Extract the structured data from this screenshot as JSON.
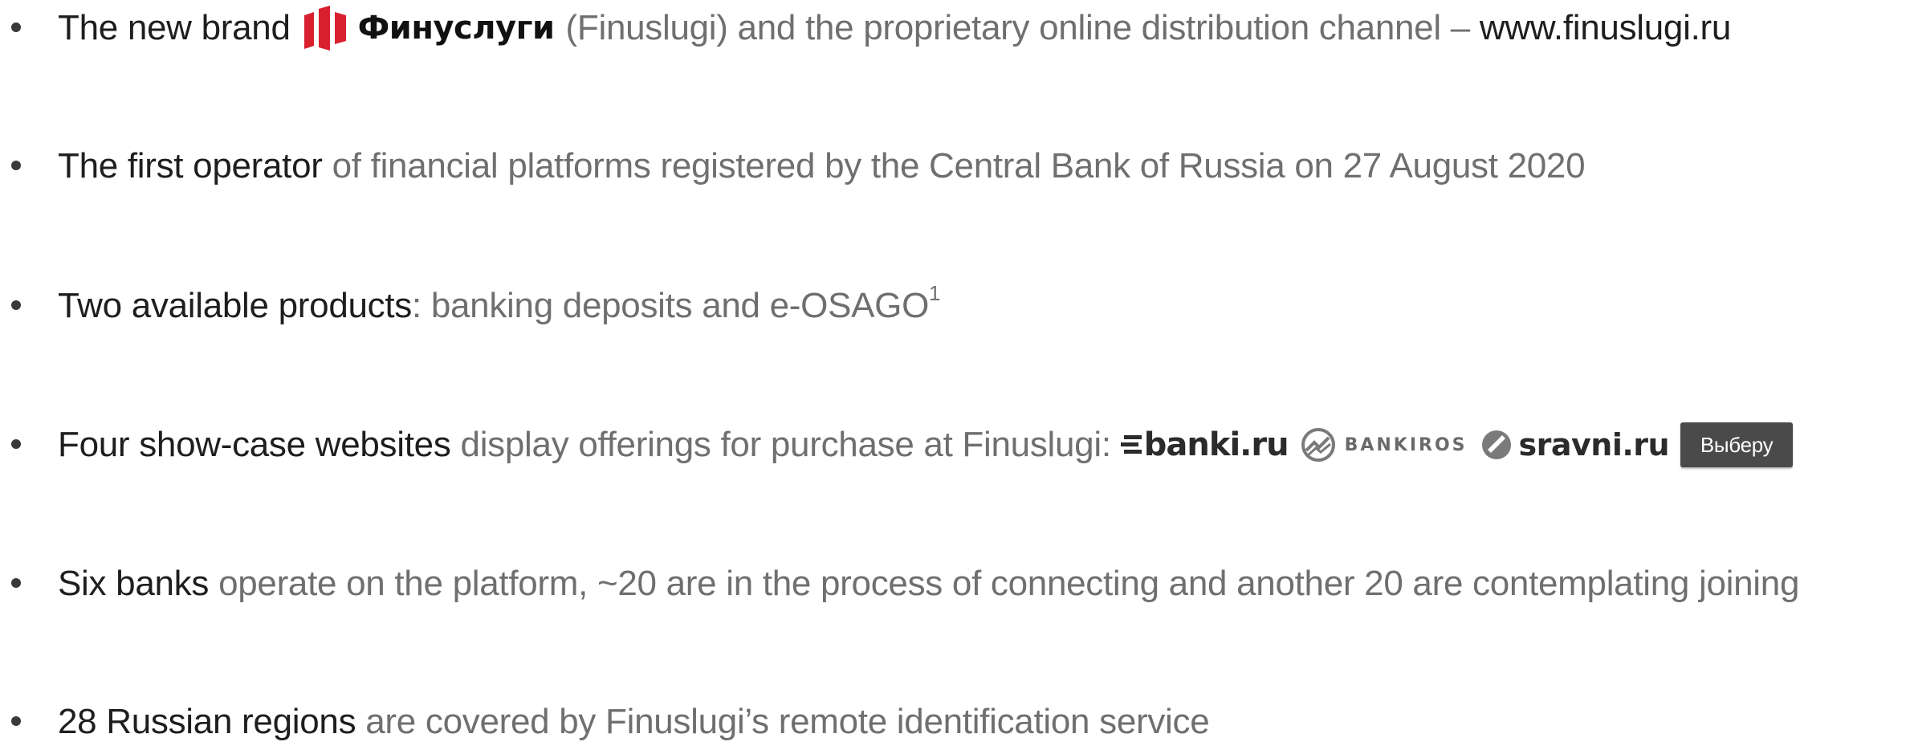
{
  "bullets": [
    {
      "lead": "The new brand",
      "brand_name": "Финуслуги",
      "rest_a": "(Finuslugi) and the proprietary online distribution channel –",
      "rest_b": "www.finuslugi.ru"
    },
    {
      "lead": "The first operator",
      "rest": "of financial platforms registered by the Central Bank of Russia on 27 August 2020"
    },
    {
      "lead": "Two available products",
      "rest": ": banking deposits and e-OSAGO",
      "footnote": "1"
    },
    {
      "lead": "Four show-case websites",
      "rest": "display offerings for purchase at Finuslugi:",
      "logos": {
        "banki": "banki.ru",
        "bankiros": "BANKIROS",
        "sravni": "sravni.ru",
        "vybery": "Выберу"
      }
    },
    {
      "lead": "Six banks",
      "rest": "operate on the platform, ~20 are in the process of connecting and another 20 are contemplating joining"
    },
    {
      "lead": "28 Russian regions",
      "rest": "are covered by Finuslugi’s remote identification service"
    }
  ],
  "colors": {
    "emphasis": "#1e1e1e",
    "body": "#6f6f6f",
    "brand_red": "#d8202f"
  }
}
